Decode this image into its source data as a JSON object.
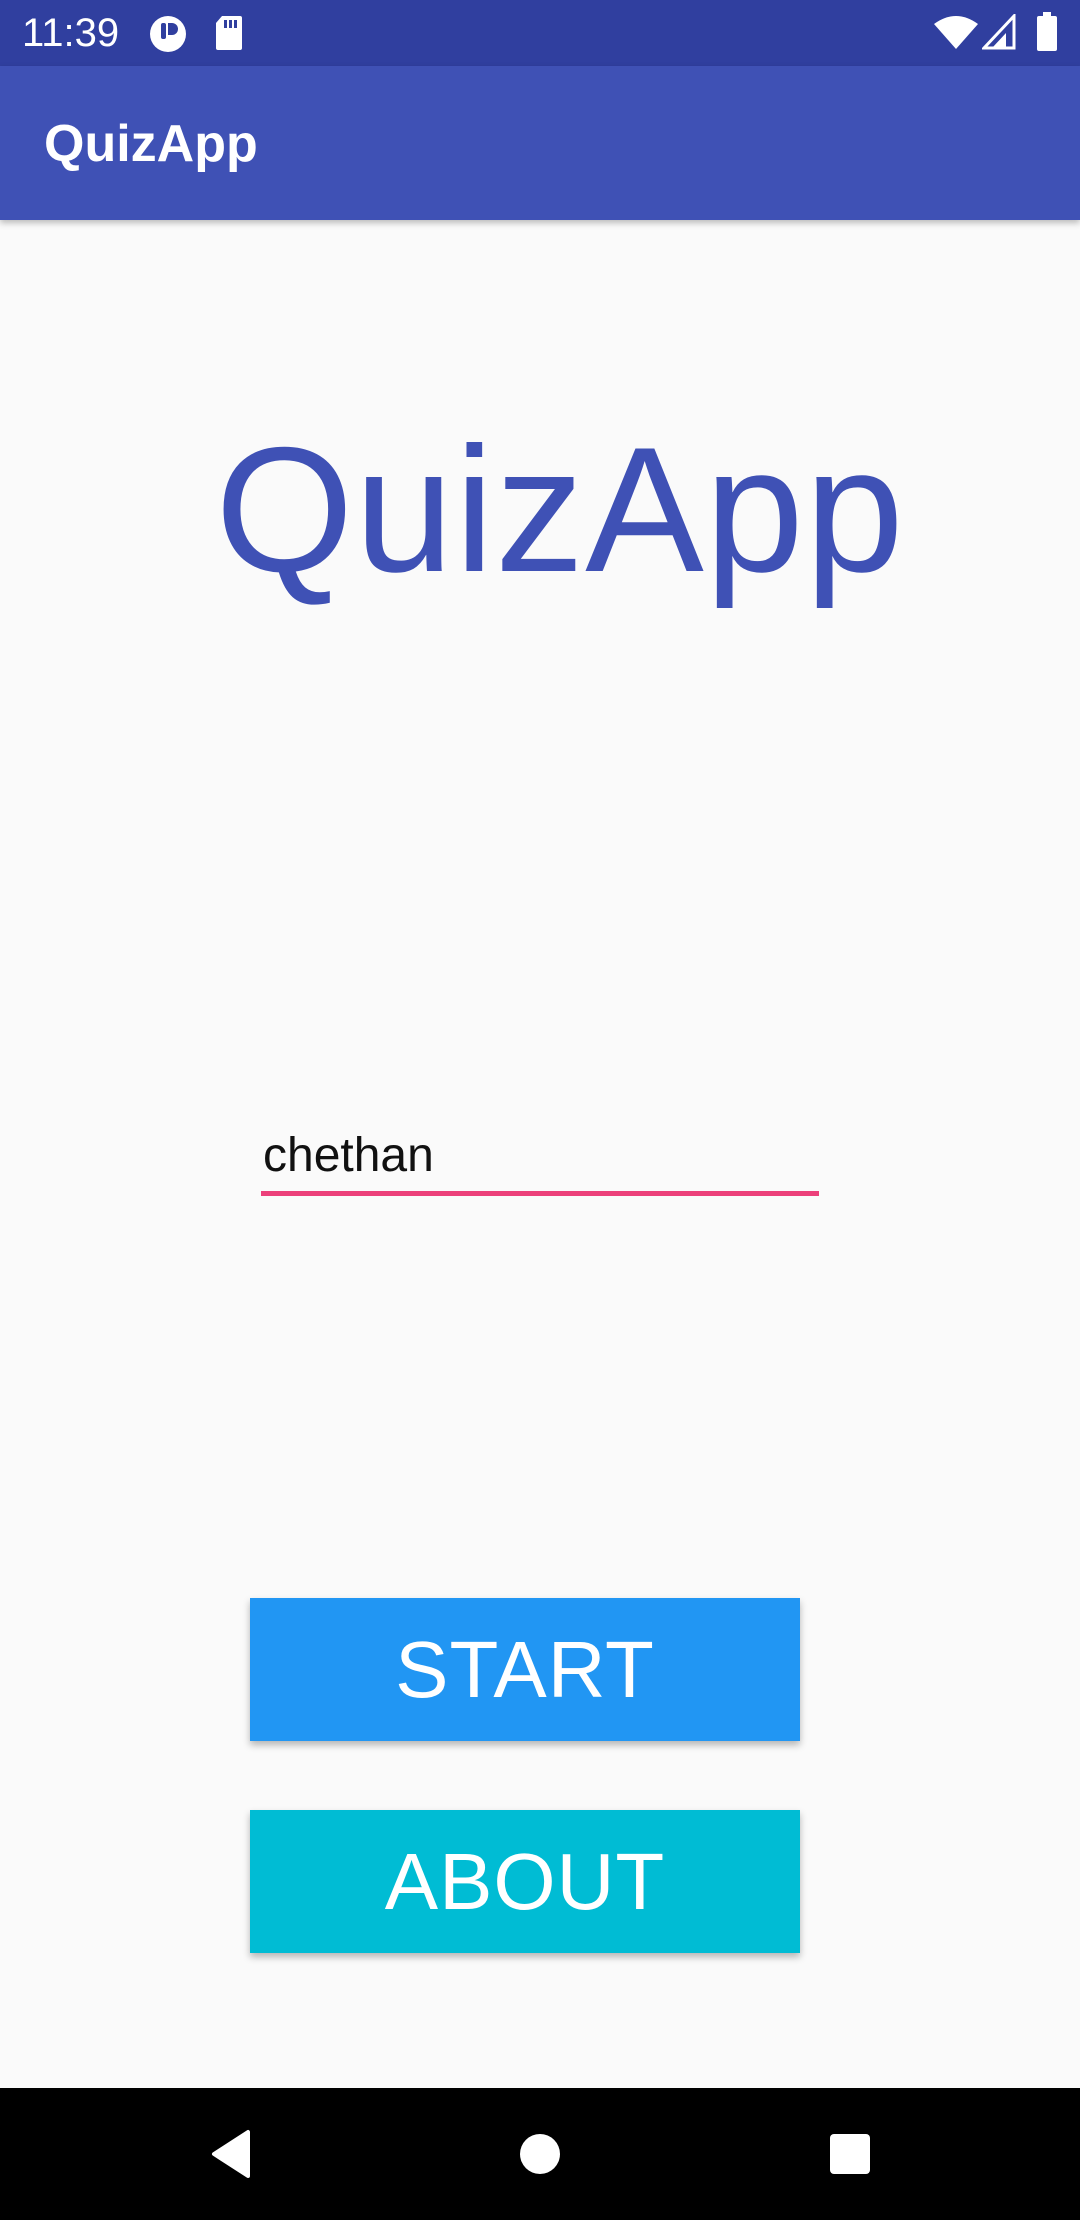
{
  "status_bar": {
    "time": "11:39",
    "icons": [
      "notification-app-icon",
      "sd-card-icon",
      "wifi-icon",
      "signal-icon",
      "battery-icon"
    ]
  },
  "app_bar": {
    "title": "QuizApp"
  },
  "main": {
    "logo_text": "QuizApp",
    "name_input": {
      "value": "chethan"
    },
    "start_label": "START",
    "about_label": "ABOUT"
  },
  "nav_bar": {
    "icons": [
      "back-icon",
      "home-icon",
      "recents-icon"
    ]
  },
  "colors": {
    "status_bar": "#303f9f",
    "app_bar": "#3f51b5",
    "title_text": "#3f51b5",
    "input_underline": "#ec407a",
    "start_button": "#2196f3",
    "about_button": "#00bcd4",
    "background": "#fafafa"
  }
}
